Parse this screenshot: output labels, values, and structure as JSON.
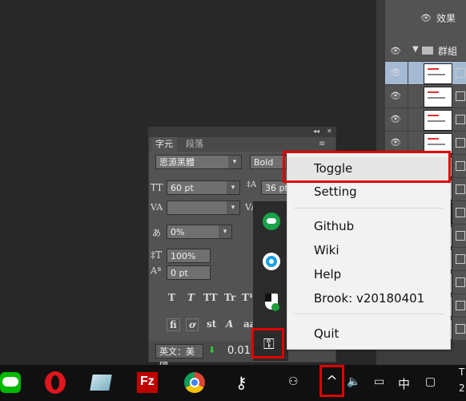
{
  "layers_panel": {
    "effects_label": "效果",
    "group_label": "群組"
  },
  "character_panel": {
    "tabs": [
      "字元",
      "段落"
    ],
    "font_family": "思源黑體",
    "font_style": "Bold",
    "font_size": "60 pt",
    "leading": "36 pt",
    "kerning": "",
    "tracking": "0%",
    "vertical_scale": "100%",
    "baseline_shift": "0 pt",
    "language": "英文：美國",
    "value_preview": "0.01",
    "style_buttons": [
      "T",
      "T",
      "TT",
      "Tr",
      "T¹",
      "T₁",
      "T",
      "T"
    ],
    "ligature_buttons": [
      "fi",
      "ơ",
      "st",
      "A",
      "aa"
    ]
  },
  "context_menu": {
    "items": [
      "Toggle",
      "Setting",
      "Github",
      "Wiki",
      "Help",
      "Brook: v20180401",
      "Quit"
    ]
  },
  "tray": {
    "icons": [
      "cloud-icon",
      "lens-icon",
      "shield-icon",
      "key-icon"
    ]
  },
  "taskbar": {
    "apps": [
      "line-icon",
      "opera-icon",
      "notes-icon",
      "filezilla-icon",
      "chrome-icon",
      "key-app-icon"
    ],
    "ime_label": "中",
    "clock_partial": "T",
    "clock_partial2": "2"
  },
  "colors": {
    "highlight_red": "#e00000",
    "line_green": "#00b900",
    "opera_red": "#e0161e",
    "filezilla_red": "#bf0000"
  }
}
